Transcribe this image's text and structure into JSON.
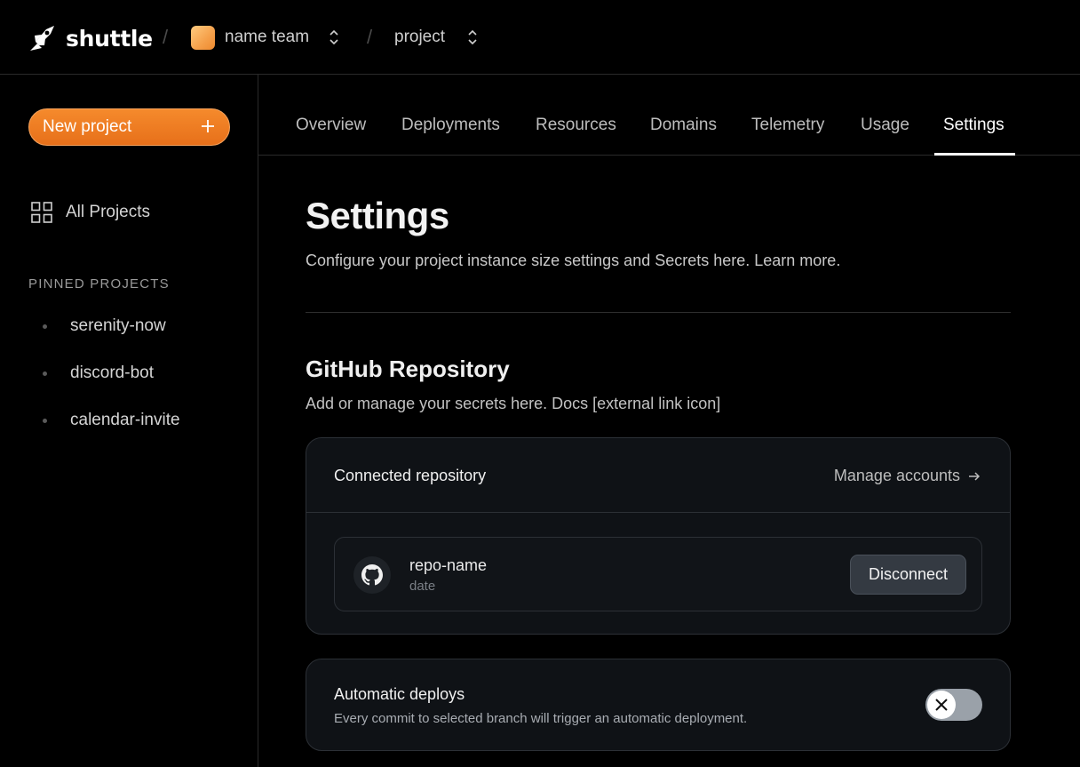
{
  "topbar": {
    "brand": "shuttle",
    "team_name": "name team",
    "project_name": "project"
  },
  "sidebar": {
    "new_project_label": "New project",
    "all_projects_label": "All Projects",
    "pinned_heading": "PINNED PROJECTS",
    "pinned": [
      "serenity-now",
      "discord-bot",
      "calendar-invite"
    ]
  },
  "tabs": [
    "Overview",
    "Deployments",
    "Resources",
    "Domains",
    "Telemetry",
    "Usage",
    "Settings"
  ],
  "active_tab": "Settings",
  "page": {
    "title": "Settings",
    "subtitle": "Configure your project instance size settings and Secrets here. Learn more."
  },
  "github": {
    "title": "GitHub Repository",
    "subtitle": "Add or manage your secrets here. Docs [external link icon]",
    "connected_label": "Connected repository",
    "manage_label": "Manage accounts",
    "repo_name": "repo-name",
    "repo_date": "date",
    "disconnect_label": "Disconnect"
  },
  "auto_deploys": {
    "title": "Automatic deploys",
    "description": "Every commit to selected branch will trigger an automatic deployment.",
    "enabled": false
  },
  "colors": {
    "accent": "#f0801f",
    "background": "#000000",
    "card": "#0f1216"
  }
}
